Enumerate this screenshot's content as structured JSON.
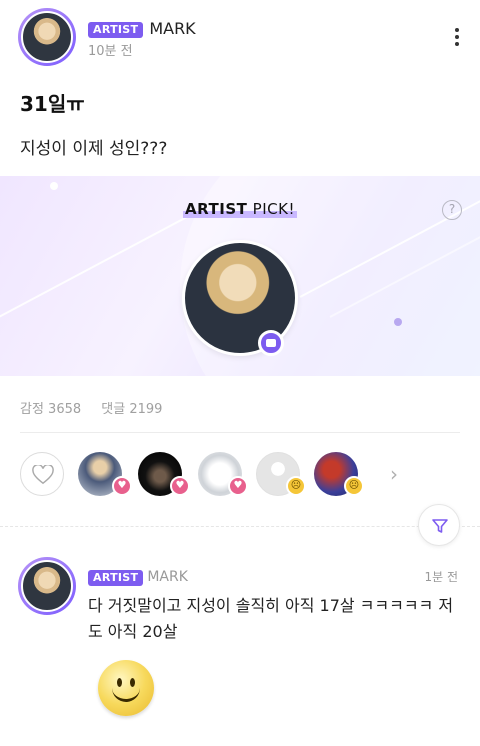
{
  "post": {
    "badge": "ARTIST",
    "author": "MARK",
    "time": "10분 전",
    "title": "31일ㅠ",
    "body": "지성이 이제 성인???"
  },
  "pick": {
    "title_bold": "ARTIST",
    "title_rest": " PICK!",
    "help": "?"
  },
  "stats": {
    "feel": "감정 3658",
    "comments": "댓글 2199"
  },
  "reactions": {
    "more_icon": "chevron-right-icon",
    "heart_badge": "♥",
    "sad_badge": "☹"
  },
  "comment": {
    "badge": "ARTIST",
    "author": "MARK",
    "time": "1분 전",
    "text": "다 거짓말이고 지성이 솔직히 아직 17살 ㅋㅋㅋㅋㅋ 저도 아직 20살"
  },
  "colors": {
    "accent": "#7d5cf0",
    "heart": "#e8608d",
    "sad": "#f5c638"
  }
}
